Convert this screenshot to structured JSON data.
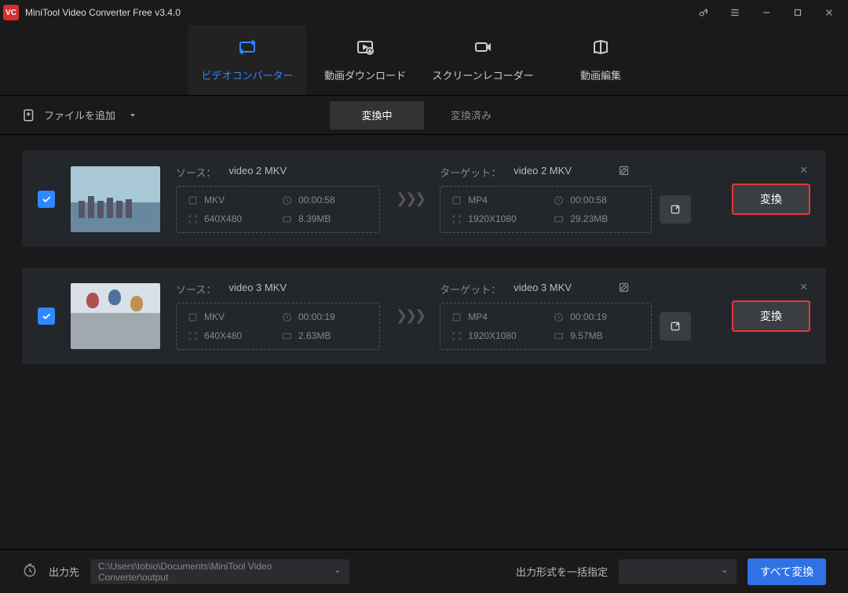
{
  "app": {
    "title": "MiniTool Video Converter Free v3.4.0",
    "logo_text": "VC"
  },
  "nav": {
    "tabs": [
      {
        "label": "ビデオコンバーター"
      },
      {
        "label": "動画ダウンロード"
      },
      {
        "label": "スクリーンレコーダー"
      },
      {
        "label": "動画編集"
      }
    ]
  },
  "toolbar": {
    "add_file_label": "ファイルを追加",
    "status_converting": "変換中",
    "status_done": "変換済み"
  },
  "items": [
    {
      "source_label": "ソース：",
      "source_name": "video 2 MKV",
      "src_format": "MKV",
      "src_duration": "00:00:58",
      "src_resolution": "640X480",
      "src_size": "8.39MB",
      "target_label": "ターゲット：",
      "target_name": "video 2 MKV",
      "tgt_format": "MP4",
      "tgt_duration": "00:00:58",
      "tgt_resolution": "1920X1080",
      "tgt_size": "29.23MB",
      "convert_label": "変換"
    },
    {
      "source_label": "ソース：",
      "source_name": "video 3 MKV",
      "src_format": "MKV",
      "src_duration": "00:00:19",
      "src_resolution": "640X480",
      "src_size": "2.63MB",
      "target_label": "ターゲット：",
      "target_name": "video 3 MKV",
      "tgt_format": "MP4",
      "tgt_duration": "00:00:19",
      "tgt_resolution": "1920X1080",
      "tgt_size": "9.57MB",
      "convert_label": "変換"
    }
  ],
  "bottom": {
    "output_label": "出力先",
    "output_path": "C:\\Users\\tobio\\Documents\\MiniTool Video Converter\\output",
    "batch_label": "出力形式を一括指定",
    "convert_all_label": "すべて変換"
  }
}
